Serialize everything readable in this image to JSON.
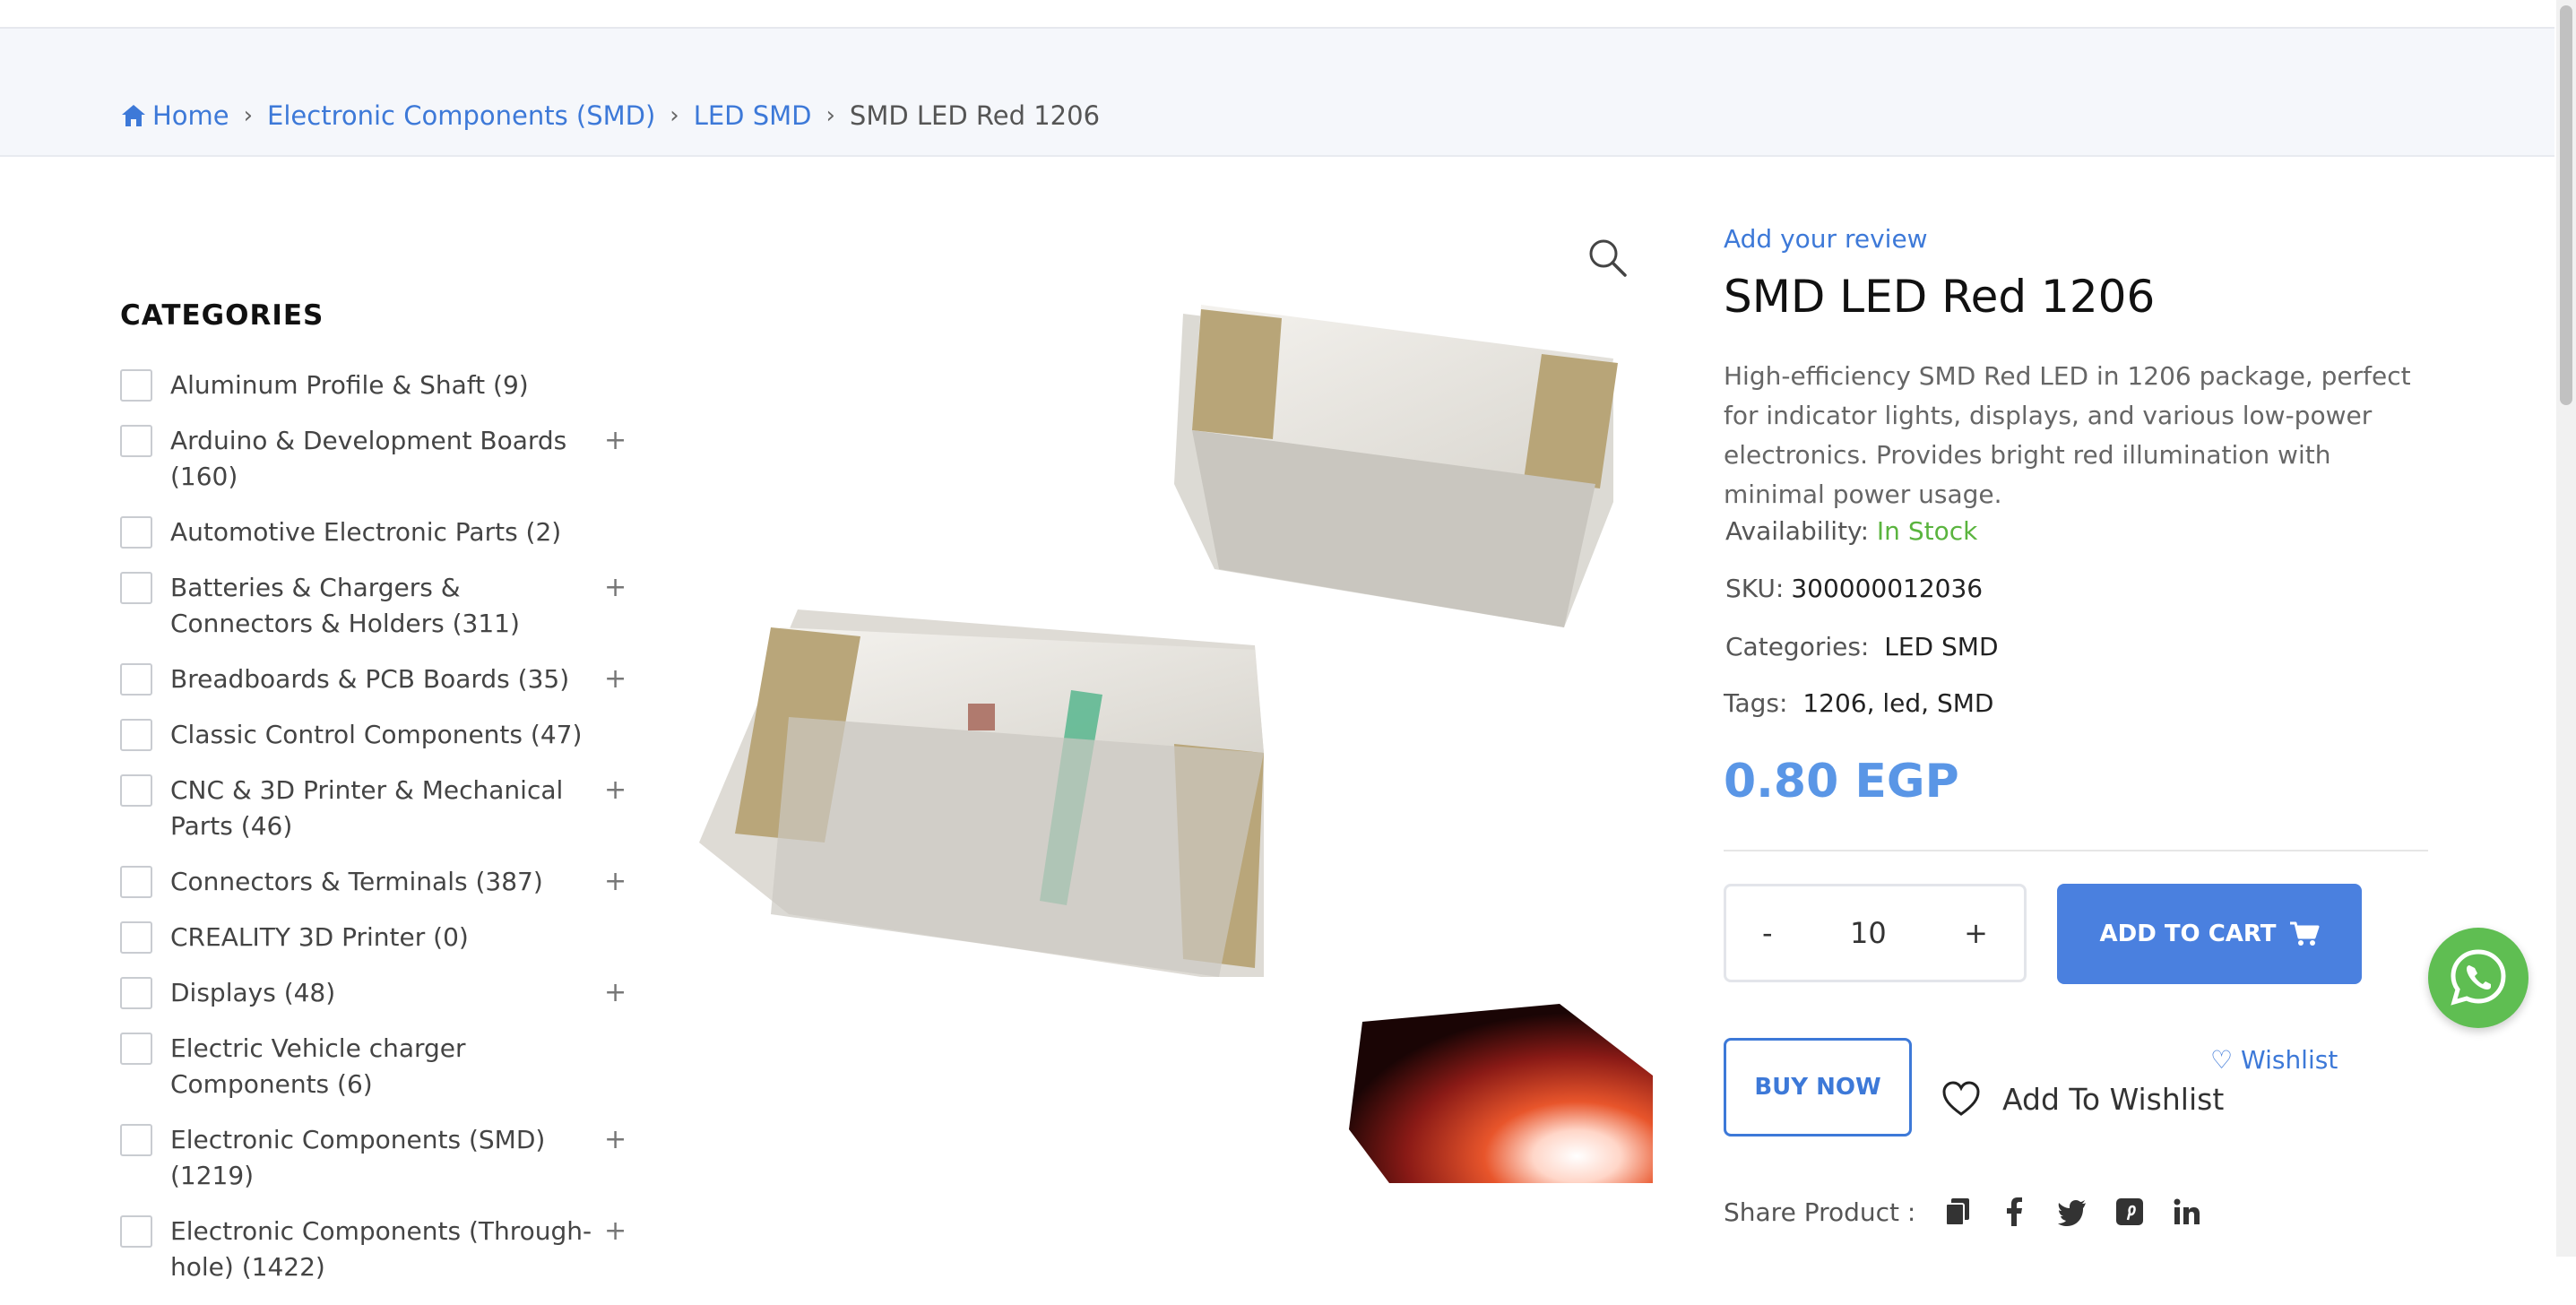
{
  "breadcrumb": {
    "home": "Home",
    "items": [
      "Electronic Components (SMD)",
      "LED SMD"
    ],
    "current": "SMD LED Red 1206",
    "separator": "›"
  },
  "sidebar": {
    "title": "CATEGORIES",
    "items": [
      {
        "label": "Aluminum Profile & Shaft (9)",
        "expandable": false
      },
      {
        "label": "Arduino & Development Boards (160)",
        "expandable": true
      },
      {
        "label": "Automotive Electronic Parts (2)",
        "expandable": false
      },
      {
        "label": "Batteries & Chargers & Connectors & Holders (311)",
        "expandable": true
      },
      {
        "label": "Breadboards & PCB Boards (35)",
        "expandable": true
      },
      {
        "label": "Classic Control Components (47)",
        "expandable": false
      },
      {
        "label": "CNC & 3D Printer & Mechanical Parts (46)",
        "expandable": true
      },
      {
        "label": "Connectors & Terminals (387)",
        "expandable": true
      },
      {
        "label": "CREALITY 3D Printer (0)",
        "expandable": false
      },
      {
        "label": "Displays (48)",
        "expandable": true
      },
      {
        "label": "Electric Vehicle charger Components (6)",
        "expandable": false
      },
      {
        "label": "Electronic Components (SMD) (1219)",
        "expandable": true
      },
      {
        "label": "Electronic Components (Through-hole) (1422)",
        "expandable": true
      }
    ],
    "plus_glyph": "+"
  },
  "product": {
    "review_link": "Add your review",
    "title": "SMD LED Red 1206",
    "description": "High-efficiency SMD Red LED in 1206 package, perfect for indicator lights, displays, and various low-power electronics. Provides bright red illumination with minimal power usage.",
    "availability_label": "Availability:",
    "availability_value": "In Stock",
    "sku_label": "SKU:",
    "sku_value": "300000012036",
    "categories_label": "Categories:",
    "categories_value": "LED SMD",
    "tags_label": "Tags:",
    "tags_value": "1206, led, SMD",
    "price": "0.80 EGP"
  },
  "purchase": {
    "minus": "-",
    "quantity": "10",
    "plus": "+",
    "add_to_cart": "ADD TO CART",
    "buy_now": "BUY NOW",
    "wishlist_small": "♡ Wishlist",
    "add_to_wishlist": "Add To Wishlist"
  },
  "share": {
    "label": "Share Product :",
    "icons": [
      "copy-icon",
      "facebook-icon",
      "twitter-icon",
      "pinterest-icon",
      "linkedin-icon"
    ]
  },
  "colors": {
    "accent": "#3d79d8",
    "button": "#4a80df",
    "price": "#5a96e6",
    "in_stock": "#5ab43e",
    "whatsapp": "#5fbe52"
  }
}
